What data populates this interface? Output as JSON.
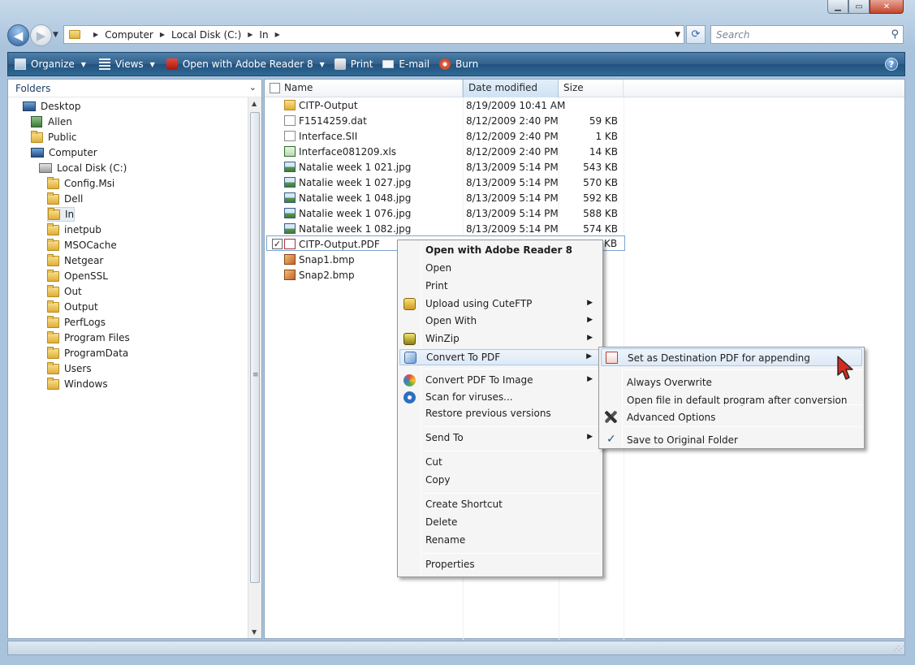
{
  "address": {
    "crumbs": [
      "Computer",
      "Local Disk (C:)",
      "In"
    ],
    "search_placeholder": "Search"
  },
  "toolbar": {
    "organize": "Organize",
    "views": "Views",
    "open_with": "Open with Adobe Reader 8",
    "print": "Print",
    "email": "E-mail",
    "burn": "Burn",
    "help": "?"
  },
  "folders": {
    "header": "Folders",
    "items": [
      {
        "label": "Desktop",
        "icon": "desktop-icon"
      },
      {
        "label": "Allen",
        "icon": "user-folder-icon"
      },
      {
        "label": "Public",
        "icon": "folder-icon"
      },
      {
        "label": "Computer",
        "icon": "computer-icon"
      },
      {
        "label": "Local Disk (C:)",
        "icon": "drive-icon"
      },
      {
        "label": "Config.Msi",
        "icon": "folder-icon"
      },
      {
        "label": "Dell",
        "icon": "folder-icon"
      },
      {
        "label": "In",
        "icon": "folder-icon",
        "selected": true
      },
      {
        "label": "inetpub",
        "icon": "folder-icon"
      },
      {
        "label": "MSOCache",
        "icon": "folder-icon"
      },
      {
        "label": "Netgear",
        "icon": "folder-icon"
      },
      {
        "label": "OpenSSL",
        "icon": "folder-icon"
      },
      {
        "label": "Out",
        "icon": "folder-icon"
      },
      {
        "label": "Output",
        "icon": "folder-icon"
      },
      {
        "label": "PerfLogs",
        "icon": "folder-icon"
      },
      {
        "label": "Program Files",
        "icon": "folder-icon"
      },
      {
        "label": "ProgramData",
        "icon": "folder-icon"
      },
      {
        "label": "Users",
        "icon": "folder-icon"
      },
      {
        "label": "Windows",
        "icon": "folder-icon"
      }
    ]
  },
  "files": {
    "columns": [
      "Name",
      "Date modified",
      "Size"
    ],
    "rows": [
      {
        "name": "CITP-Output",
        "date": "8/19/2009 10:41 AM",
        "size": "",
        "icon": "folder-icon"
      },
      {
        "name": "F1514259.dat",
        "date": "8/12/2009 2:40 PM",
        "size": "59 KB",
        "icon": "file-icon"
      },
      {
        "name": "Interface.SII",
        "date": "8/12/2009 2:40 PM",
        "size": "1 KB",
        "icon": "file-icon"
      },
      {
        "name": "Interface081209.xls",
        "date": "8/12/2009 2:40 PM",
        "size": "14 KB",
        "icon": "excel-icon"
      },
      {
        "name": "Natalie week 1 021.jpg",
        "date": "8/13/2009 5:14 PM",
        "size": "543 KB",
        "icon": "image-icon"
      },
      {
        "name": "Natalie week 1 027.jpg",
        "date": "8/13/2009 5:14 PM",
        "size": "570 KB",
        "icon": "image-icon"
      },
      {
        "name": "Natalie week 1 048.jpg",
        "date": "8/13/2009 5:14 PM",
        "size": "592 KB",
        "icon": "image-icon"
      },
      {
        "name": "Natalie week 1 076.jpg",
        "date": "8/13/2009 5:14 PM",
        "size": "588 KB",
        "icon": "image-icon"
      },
      {
        "name": "Natalie week 1 082.jpg",
        "date": "8/13/2009 5:14 PM",
        "size": "574 KB",
        "icon": "image-icon"
      },
      {
        "name": "CITP-Output.PDF",
        "date": "",
        "size": "KB",
        "icon": "pdf-icon",
        "selected": true
      },
      {
        "name": "Snap1.bmp",
        "date": "",
        "size": "",
        "icon": "bitmap-icon"
      },
      {
        "name": "Snap2.bmp",
        "date": "",
        "size": "",
        "icon": "bitmap-icon"
      }
    ]
  },
  "context_menu": {
    "items": [
      {
        "label": "Open with Adobe Reader 8",
        "bold": true
      },
      {
        "label": "Open"
      },
      {
        "label": "Print"
      },
      {
        "label": "Upload using CuteFTP",
        "submenu": true,
        "icon": "cuteftp-icon"
      },
      {
        "label": "Open With",
        "submenu": true
      },
      {
        "label": "WinZip",
        "submenu": true,
        "icon": "winzip-icon"
      },
      {
        "label": "Convert To PDF",
        "submenu": true,
        "icon": "convert-pdf-icon",
        "highlighted": true
      },
      {
        "label": "Convert PDF To Image",
        "submenu": true,
        "icon": "pdf-to-image-icon"
      },
      {
        "label": "Scan for viruses...",
        "icon": "antivirus-icon"
      },
      {
        "label": "Restore previous versions"
      },
      {
        "label": "Send To",
        "submenu": true
      },
      {
        "label": "Cut"
      },
      {
        "label": "Copy"
      },
      {
        "label": "Create Shortcut"
      },
      {
        "label": "Delete"
      },
      {
        "label": "Rename"
      },
      {
        "label": "Properties"
      }
    ]
  },
  "submenu": {
    "items": [
      {
        "label": "Set as Destination PDF for appending",
        "icon": "pdf-append-icon",
        "highlighted": true
      },
      {
        "label": "Always Overwrite"
      },
      {
        "label": "Open file in default program after conversion"
      },
      {
        "label": "Advanced Options",
        "icon": "tools-icon"
      },
      {
        "label": "Save to Original Folder",
        "checked": true
      }
    ],
    "check_glyph": "✓"
  },
  "colors": {
    "toolbar": "#2f6390",
    "highlight": "#dde9f6",
    "selection_border": "#7da2ce"
  }
}
